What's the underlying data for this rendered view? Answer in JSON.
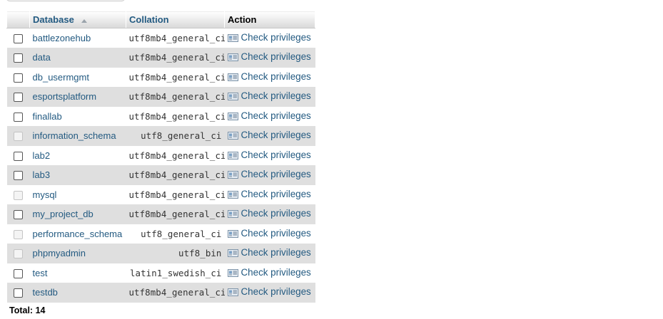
{
  "table": {
    "headers": {
      "database": "Database",
      "collation": "Collation",
      "action": "Action"
    },
    "rows": [
      {
        "name": "battlezonehub",
        "collation": "utf8mb4_general_ci",
        "action": "Check privileges",
        "checkbox_enabled": true
      },
      {
        "name": "data",
        "collation": "utf8mb4_general_ci",
        "action": "Check privileges",
        "checkbox_enabled": true
      },
      {
        "name": "db_usermgmt",
        "collation": "utf8mb4_general_ci",
        "action": "Check privileges",
        "checkbox_enabled": true
      },
      {
        "name": "esportsplatform",
        "collation": "utf8mb4_general_ci",
        "action": "Check privileges",
        "checkbox_enabled": true
      },
      {
        "name": "finallab",
        "collation": "utf8mb4_general_ci",
        "action": "Check privileges",
        "checkbox_enabled": true
      },
      {
        "name": "information_schema",
        "collation": "utf8_general_ci",
        "action": "Check privileges",
        "checkbox_enabled": false
      },
      {
        "name": "lab2",
        "collation": "utf8mb4_general_ci",
        "action": "Check privileges",
        "checkbox_enabled": true
      },
      {
        "name": "lab3",
        "collation": "utf8mb4_general_ci",
        "action": "Check privileges",
        "checkbox_enabled": true
      },
      {
        "name": "mysql",
        "collation": "utf8mb4_general_ci",
        "action": "Check privileges",
        "checkbox_enabled": false
      },
      {
        "name": "my_project_db",
        "collation": "utf8mb4_general_ci",
        "action": "Check privileges",
        "checkbox_enabled": true
      },
      {
        "name": "performance_schema",
        "collation": "utf8_general_ci",
        "action": "Check privileges",
        "checkbox_enabled": false
      },
      {
        "name": "phpmyadmin",
        "collation": "utf8_bin",
        "action": "Check privileges",
        "checkbox_enabled": false
      },
      {
        "name": "test",
        "collation": "latin1_swedish_ci",
        "action": "Check privileges",
        "checkbox_enabled": true
      },
      {
        "name": "testdb",
        "collation": "utf8mb4_general_ci",
        "action": "Check privileges",
        "checkbox_enabled": true
      }
    ]
  },
  "footer": {
    "total": "Total: 14"
  },
  "colors": {
    "link": "#235a81",
    "row_alt": "#dfdfdf"
  },
  "icons": {
    "sort": "sort-ascending-icon",
    "action": "check-privileges-icon"
  }
}
